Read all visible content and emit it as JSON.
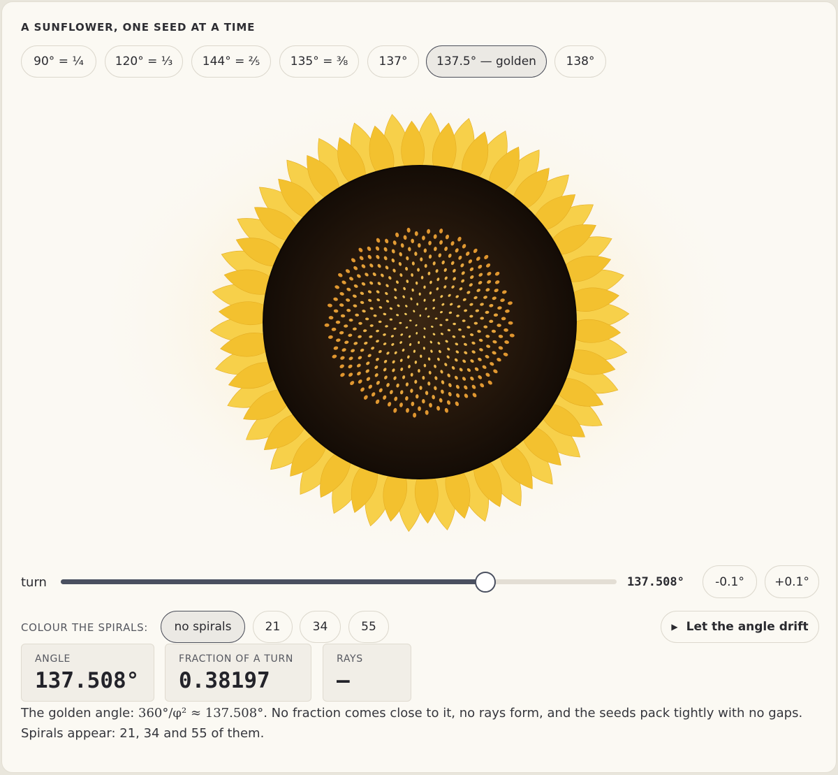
{
  "heading": "A SUNFLOWER, ONE SEED AT A TIME",
  "presets": [
    {
      "label": "90° = ¼",
      "active": false
    },
    {
      "label": "120° = ⅓",
      "active": false
    },
    {
      "label": "144° = ⅖",
      "active": false
    },
    {
      "label": "135° = ⅜",
      "active": false
    },
    {
      "label": "137°",
      "active": false
    },
    {
      "label": "137.5° — golden",
      "active": true
    },
    {
      "label": "138°",
      "active": false
    }
  ],
  "slider": {
    "label": "turn",
    "value_text": "137.508°",
    "min": 0,
    "max": 180,
    "value": 137.508
  },
  "step_buttons": {
    "minus": "-0.1°",
    "plus": "+0.1°"
  },
  "spirals": {
    "label": "COLOUR THE SPIRALS:",
    "options": [
      {
        "label": "no spirals",
        "active": true
      },
      {
        "label": "21",
        "active": false
      },
      {
        "label": "34",
        "active": false
      },
      {
        "label": "55",
        "active": false
      }
    ]
  },
  "drift_button": "Let the angle drift",
  "stats": {
    "angle": {
      "label": "ANGLE",
      "value": "137.508°"
    },
    "fraction": {
      "label": "FRACTION OF A TURN",
      "value": "0.38197"
    },
    "rays": {
      "label": "RAYS",
      "value": "—"
    }
  },
  "note": {
    "prefix": "The golden angle: ",
    "math": "360°/φ² ≈ 137.508°",
    "suffix": ". No fraction comes close to it, no rays form, and the seeds pack tightly with no gaps.",
    "line2": "Spirals appear: 21, 34 and 55 of them."
  },
  "flower": {
    "seed_count": 400,
    "petal_count": 34,
    "angle_deg": 137.508
  },
  "colors": {
    "petal": "#f4c53a",
    "disc": "#1e140b",
    "seed_center": "#f8d76b",
    "seed_edge": "#e0952e",
    "accent": "#4a5060"
  }
}
